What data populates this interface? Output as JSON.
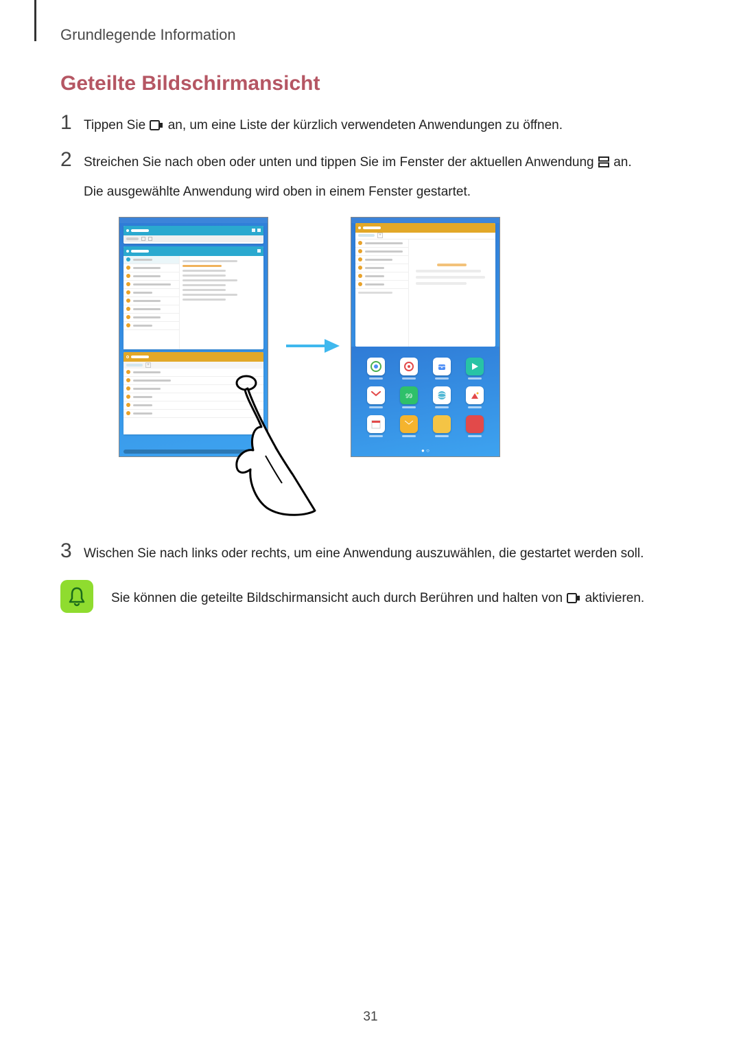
{
  "header": "Grundlegende Information",
  "title": "Geteilte Bildschirmansicht",
  "steps": {
    "s1": {
      "num": "1",
      "part_a": "Tippen Sie ",
      "part_b": " an, um eine Liste der kürzlich verwendeten Anwendungen zu öffnen."
    },
    "s2": {
      "num": "2",
      "part_a": "Streichen Sie nach oben oder unten und tippen Sie im Fenster der aktuellen Anwendung ",
      "part_b": " an.",
      "line2": "Die ausgewählte Anwendung wird oben in einem Fenster gestartet."
    },
    "s3": {
      "num": "3",
      "text": "Wischen Sie nach links oder rechts, um eine Anwendung auszuwählen, die gestartet werden soll."
    }
  },
  "callout": {
    "part_a": "Sie können die geteilte Bildschirmansicht auch durch Berühren und halten von ",
    "part_b": " aktivieren."
  },
  "page_number": "31"
}
